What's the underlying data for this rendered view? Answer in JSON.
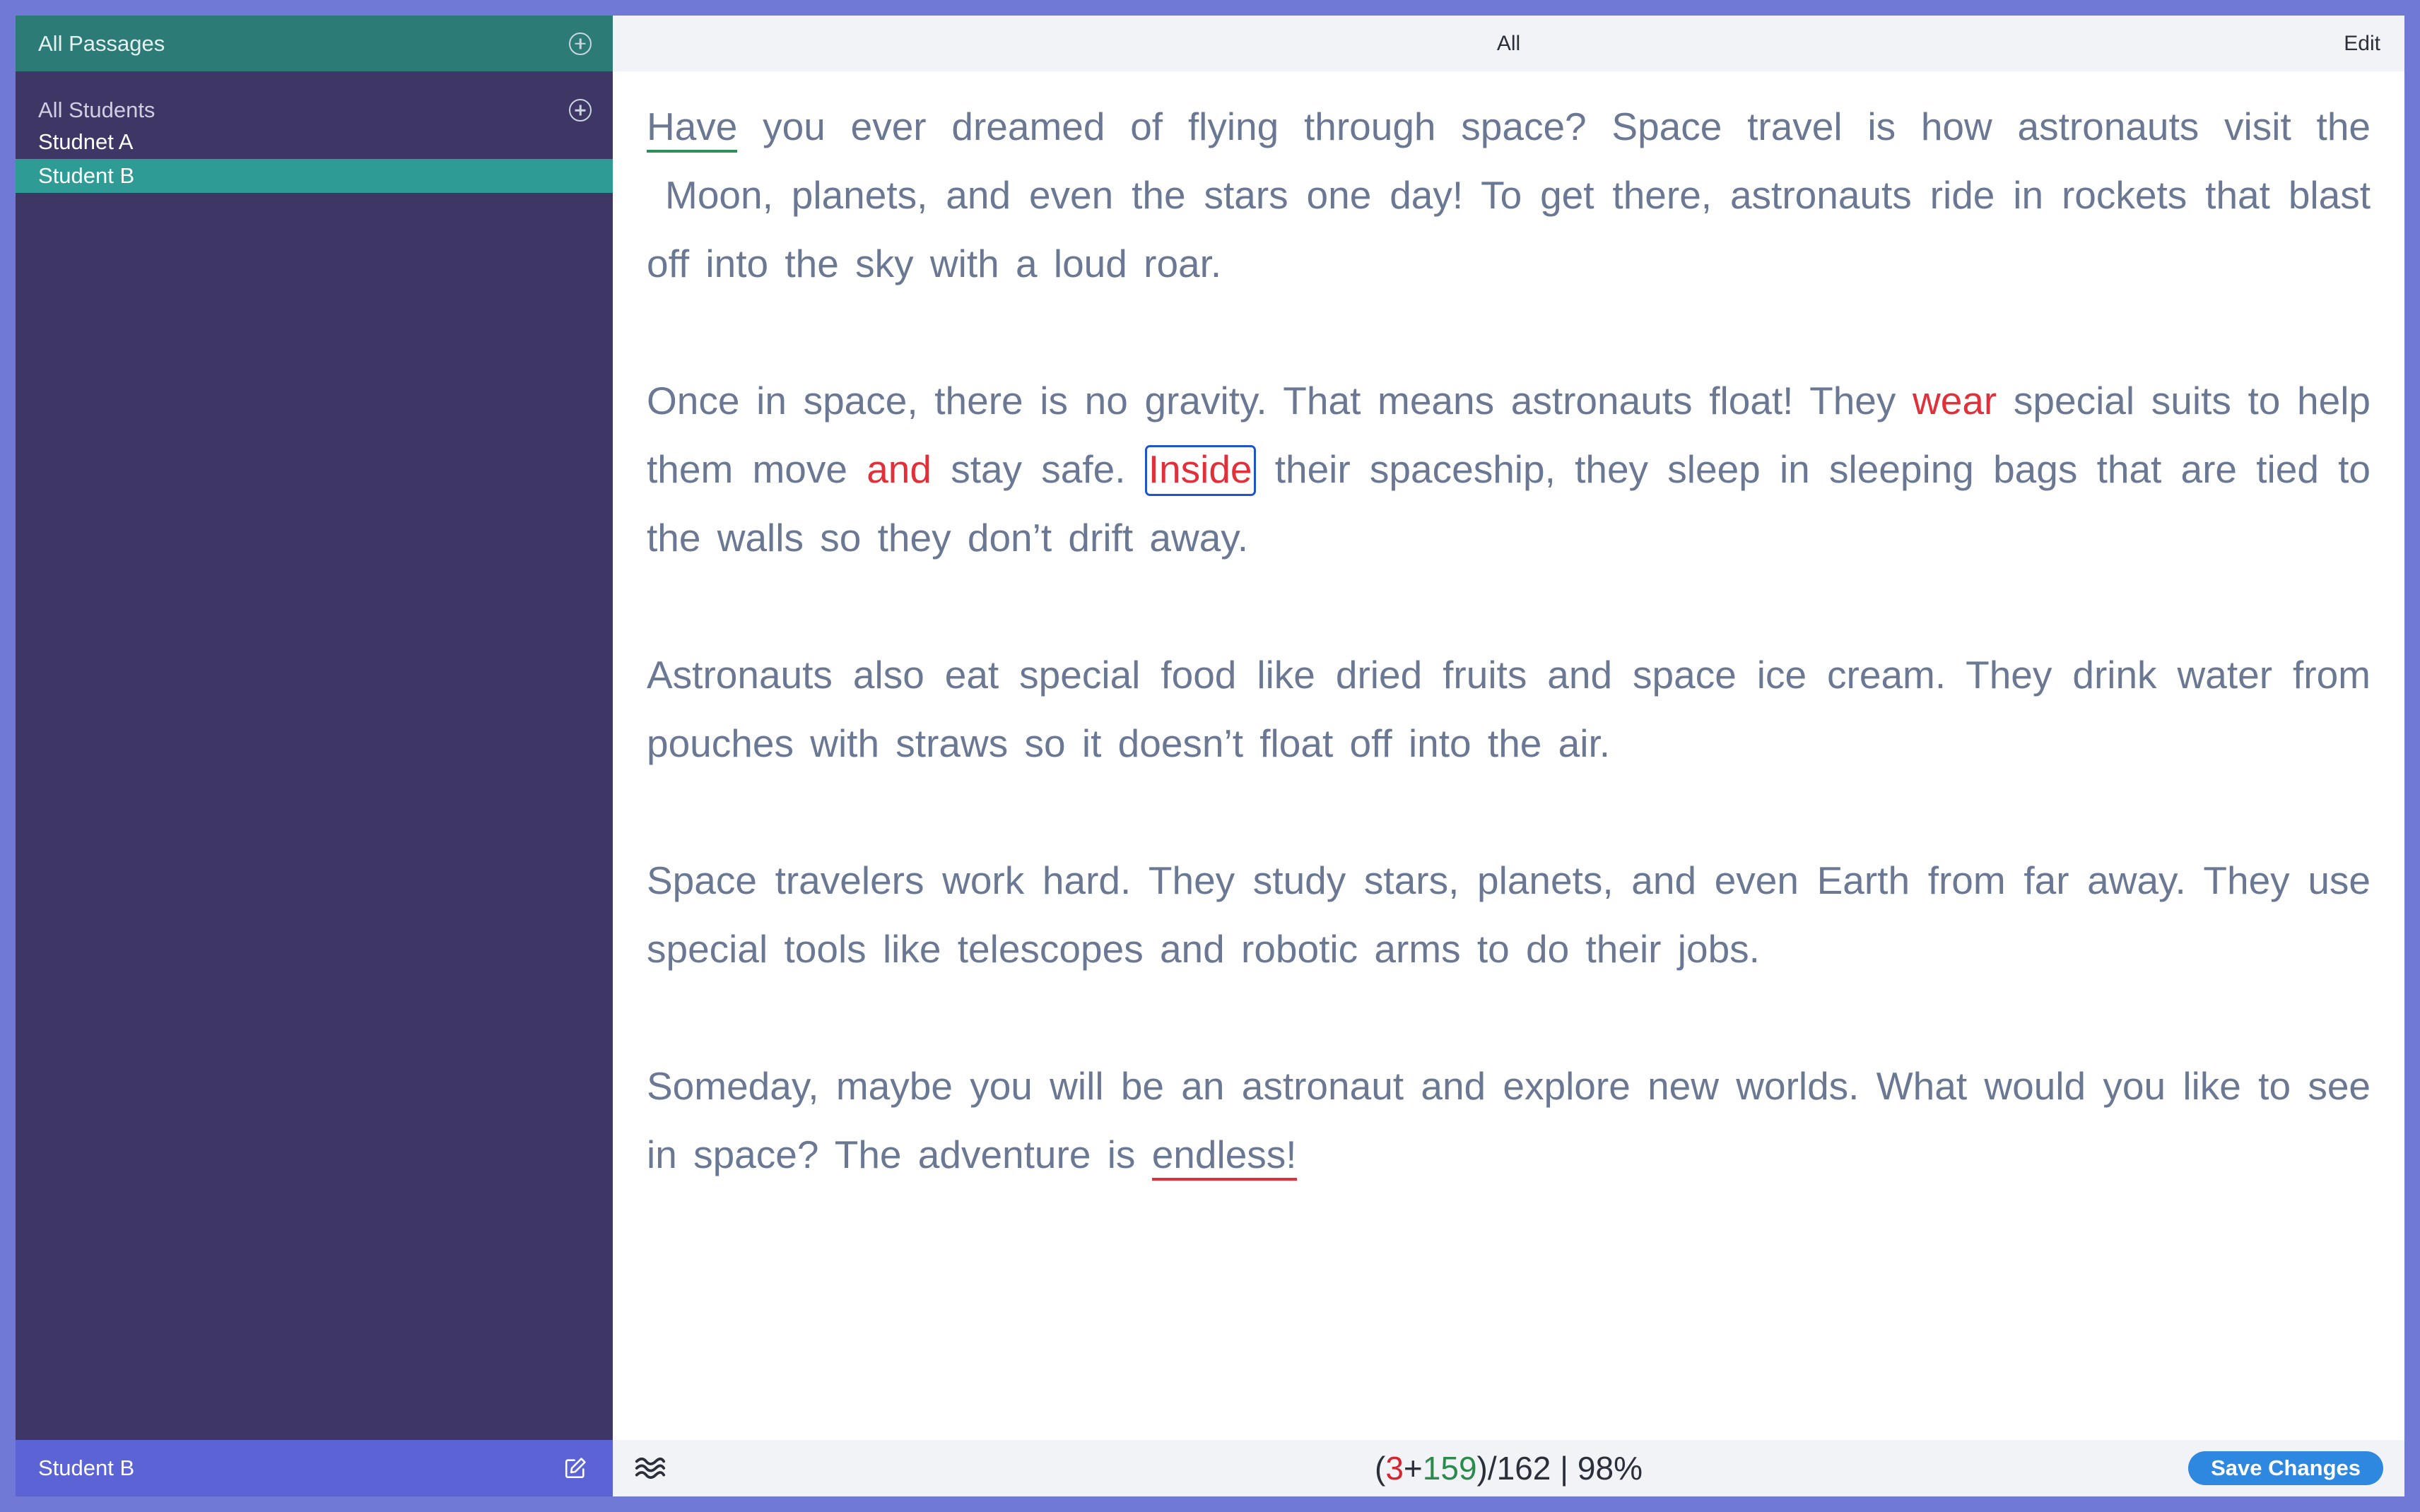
{
  "sidebar": {
    "header_title": "All Passages",
    "section_title": "All Students",
    "students": [
      {
        "label": "Studnet A"
      },
      {
        "label": "Student B"
      }
    ],
    "footer_label": "Student B"
  },
  "main": {
    "title": "All",
    "edit_label": "Edit"
  },
  "passage": {
    "p1": {
      "w_have": "Have",
      "line1_rest": "you ever dreamed of flying through space? Space travel is how astronauts visit the",
      "line2": "Moon, planets, and even the stars one day! To get there, astronauts ride in rockets that",
      "line3": "blast off into the sky with a loud roar."
    },
    "p2": {
      "a": "Once in space, there is no gravity. That means astronauts float! They",
      "w_wear": "wear",
      "b": "special suits to help them move",
      "w_and": "and",
      "c": "stay safe.",
      "w_inside": "Inside",
      "d": "their spaceship, they sleep in sleeping bags that are tied to the walls so they don’t drift away."
    },
    "p3": "Astronauts also eat special food like dried fruits and space ice cream. They drink water from pouches with straws so it doesn’t float off into the air.",
    "p4": "Space travelers work hard. They study stars, planets, and even Earth from far away. They use special tools like telescopes and robotic arms to do their jobs.",
    "p5": {
      "a": "Someday, maybe you will be an astronaut and explore new worlds. What would you like to see in space? The adventure is",
      "w_endless": "endless!"
    }
  },
  "status": {
    "open_paren": "(",
    "errors": "3",
    "plus": "+",
    "correct": "159",
    "rest": ")/162 | 98%",
    "save_label": "Save Changes"
  },
  "colors": {
    "sidebar_bg": "#3e3766",
    "sidebar_header": "#2c7b77",
    "selected_item": "#2e9c94",
    "footer_bg": "#5c64d5",
    "error_red": "#e2303a",
    "correct_green": "#2d8a4d",
    "save_button": "#2e88e0",
    "focus_box": "#1e56c9"
  },
  "icons": [
    "add-passage-icon",
    "add-student-icon",
    "edit-student-icon",
    "waveform-icon"
  ]
}
